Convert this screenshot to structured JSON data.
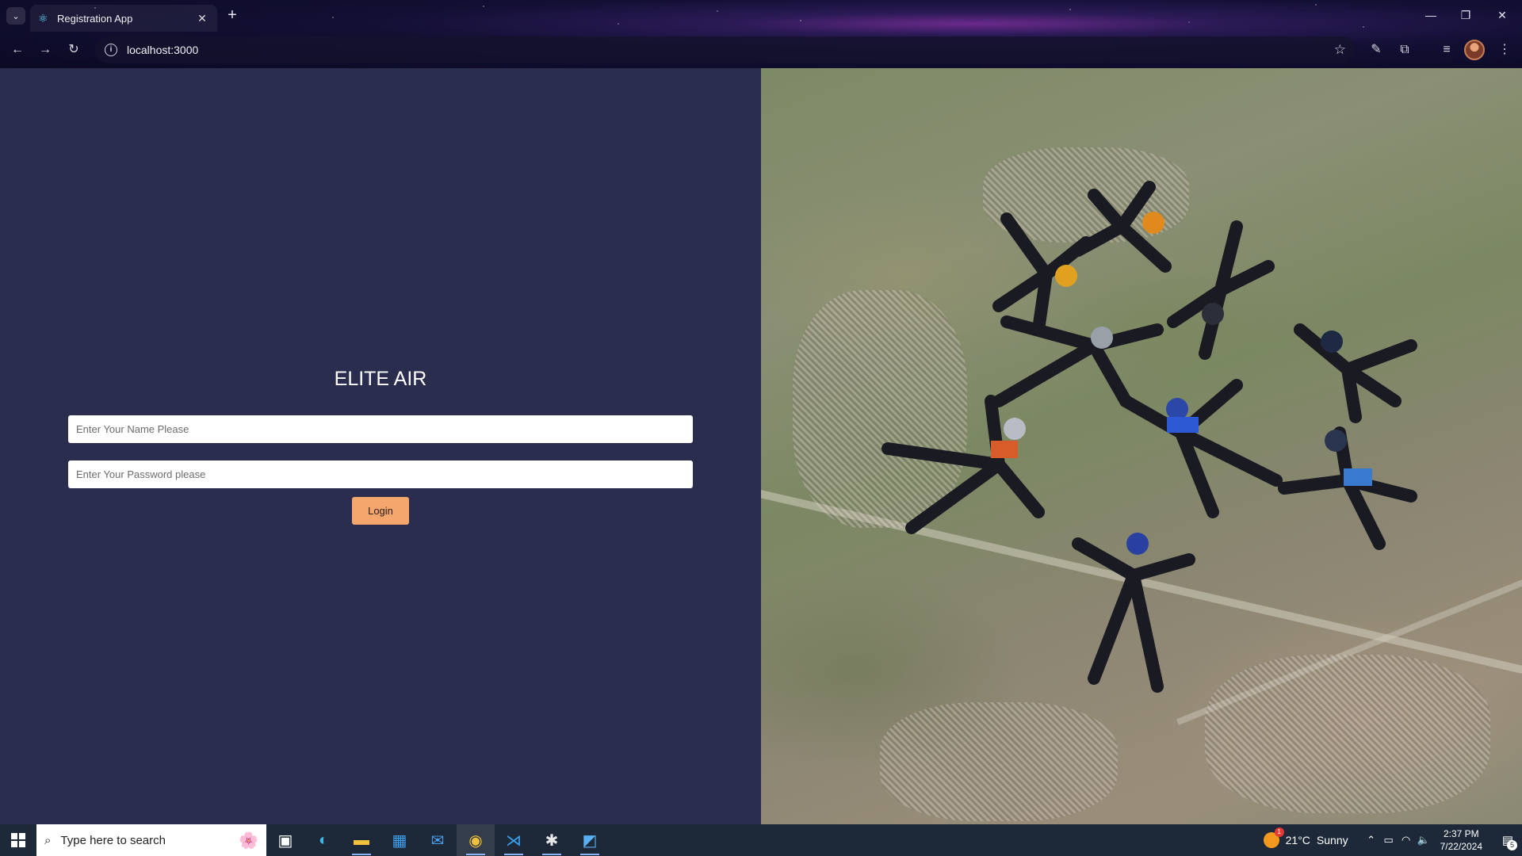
{
  "browser": {
    "tab_title": "Registration App",
    "close_glyph": "✕",
    "new_tab_glyph": "+",
    "url": "localhost:3000",
    "icons": [
      "tab-search-icon",
      "react-favicon",
      "back-icon",
      "forward-icon",
      "reload-icon",
      "site-info-icon",
      "bookmark-star-icon",
      "extensions-icon",
      "media-controls-icon",
      "profile-avatar",
      "menu-icon"
    ]
  },
  "login": {
    "brand": "ELITE AIR",
    "name_placeholder": "Enter Your Name Please",
    "password_placeholder": "Enter Your Password please",
    "login_button": "Login"
  },
  "hero_image": {
    "description_icon": "skydivers-photo"
  },
  "taskbar": {
    "search_placeholder": "Type here to search",
    "weather_temp": "21°C",
    "weather_text": "Sunny",
    "time": "2:37 PM",
    "date": "7/22/2024",
    "notification_count": "5",
    "apps": [
      "task-view-icon",
      "edge-icon",
      "file-explorer-icon",
      "microsoft-store-icon",
      "mail-icon",
      "chrome-icon",
      "vscode-icon",
      "slack-icon",
      "photos-icon"
    ]
  }
}
